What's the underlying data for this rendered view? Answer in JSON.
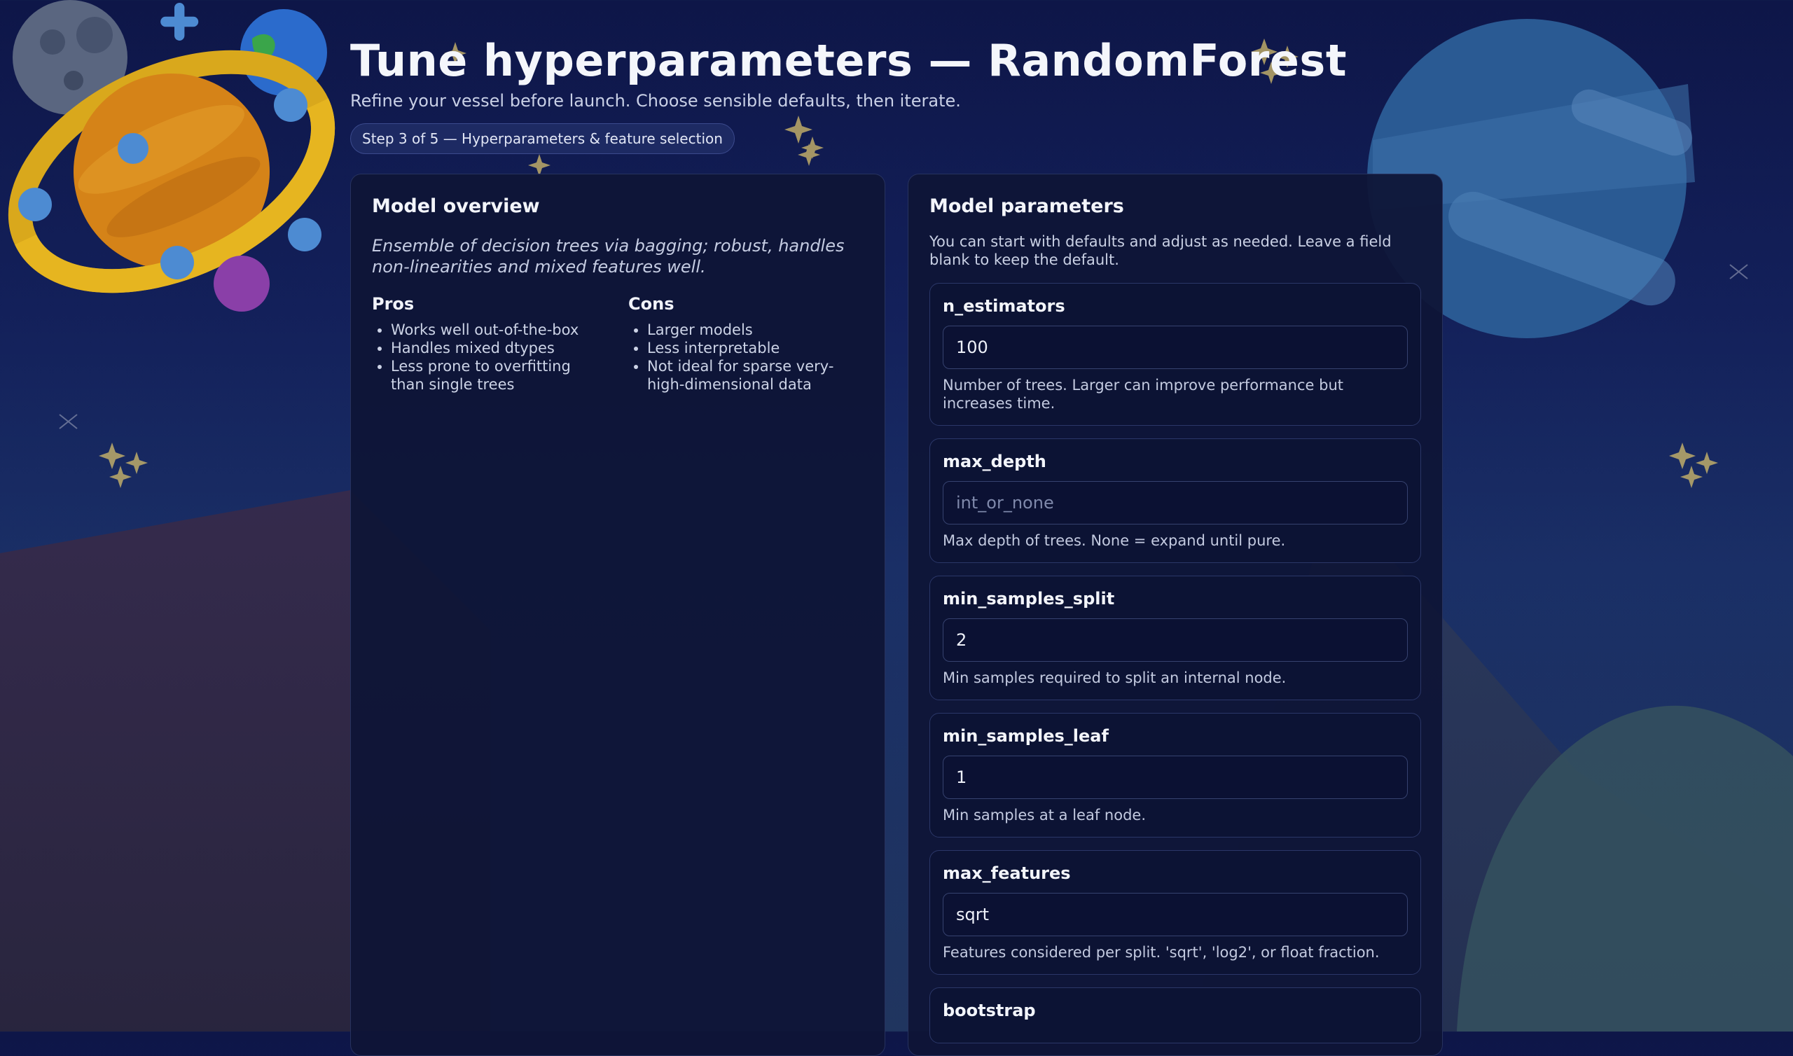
{
  "header": {
    "title": "Tune hyperparameters — RandomForest",
    "subtitle": "Refine your vessel before launch. Choose sensible defaults, then iterate.",
    "step_badge": "Step 3 of 5 — Hyperparameters & feature selection"
  },
  "overview": {
    "heading": "Model overview",
    "description": "Ensemble of decision trees via bagging; robust, handles non-linearities and mixed features well.",
    "pros_heading": "Pros",
    "pros": [
      "Works well out-of-the-box",
      "Handles mixed dtypes",
      "Less prone to overfitting than single trees"
    ],
    "cons_heading": "Cons",
    "cons": [
      "Larger models",
      "Less interpretable",
      "Not ideal for sparse very-high-dimensional data"
    ]
  },
  "parameters": {
    "heading": "Model parameters",
    "intro": "You can start with defaults and adjust as needed. Leave a field blank to keep the default.",
    "items": [
      {
        "name": "n_estimators",
        "value": "100",
        "placeholder": "",
        "help": "Number of trees. Larger can improve performance but increases time."
      },
      {
        "name": "max_depth",
        "value": "",
        "placeholder": "int_or_none",
        "help": "Max depth of trees. None = expand until pure."
      },
      {
        "name": "min_samples_split",
        "value": "2",
        "placeholder": "",
        "help": "Min samples required to split an internal node."
      },
      {
        "name": "min_samples_leaf",
        "value": "1",
        "placeholder": "",
        "help": "Min samples at a leaf node."
      },
      {
        "name": "max_features",
        "value": "sqrt",
        "placeholder": "",
        "help": "Features considered per split. 'sqrt', 'log2', or float fraction."
      },
      {
        "name": "bootstrap",
        "value": "",
        "placeholder": "",
        "help": ""
      }
    ]
  },
  "icons": [
    "planet-icon",
    "moon-icon",
    "sparkle-icon",
    "earth-icon"
  ]
}
